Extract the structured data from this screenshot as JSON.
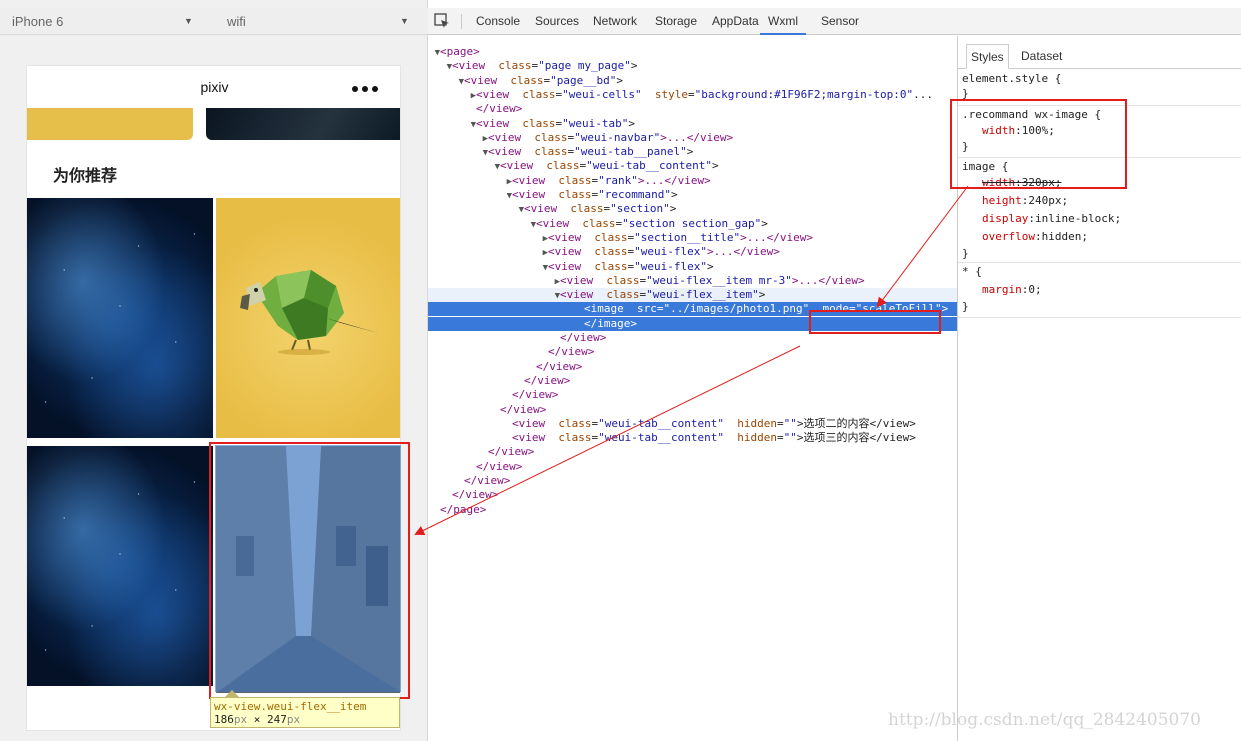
{
  "simulator": {
    "device": "iPhone 6",
    "network": "wifi",
    "nav_title": "pixiv",
    "section_title": "为你推荐",
    "tooltip_tag": "wx-view.weui-flex__item",
    "tooltip_width": "186",
    "tooltip_height": "247",
    "tooltip_unit": "px",
    "tooltip_times": "×"
  },
  "devtools": {
    "tabs": [
      "Console",
      "Sources",
      "Network",
      "Storage",
      "AppData",
      "Wxml",
      "Sensor"
    ],
    "active_tab": "Wxml",
    "wxml": [
      {
        "tri": "▼",
        "tag": "<page>",
        "a1": "",
        "v1": "",
        "a2": "",
        "v2": "",
        "rest": ""
      },
      {
        "tri": "▼",
        "tag": "<view",
        "a1": "class",
        "v1": "\"page my_page\"",
        "a2": "",
        "v2": "",
        "rest": ">"
      },
      {
        "tri": "▼",
        "tag": "<view",
        "a1": "class",
        "v1": "\"page__bd\"",
        "a2": "",
        "v2": "",
        "rest": ">"
      },
      {
        "tri": "▶",
        "tag": "<view",
        "a1": "class",
        "v1": "\"weui-cells\"",
        "a2": "style",
        "v2": "\"background:#1F96F2;margin-top:0\"",
        "rest": "..."
      },
      {
        "tri": "",
        "tag": "</view>",
        "a1": "",
        "v1": "",
        "a2": "",
        "v2": "",
        "rest": ""
      },
      {
        "tri": "▼",
        "tag": "<view",
        "a1": "class",
        "v1": "\"weui-tab\"",
        "a2": "",
        "v2": "",
        "rest": ">"
      },
      {
        "tri": "▶",
        "tag": "<view",
        "a1": "class",
        "v1": "\"weui-navbar\"",
        "a2": "",
        "v2": "",
        "rest": ">...</view>"
      },
      {
        "tri": "▼",
        "tag": "<view",
        "a1": "class",
        "v1": "\"weui-tab__panel\"",
        "a2": "",
        "v2": "",
        "rest": ">"
      },
      {
        "tri": "▼",
        "tag": "<view",
        "a1": "class",
        "v1": "\"weui-tab__content\"",
        "a2": "",
        "v2": "",
        "rest": ">"
      },
      {
        "tri": "▶",
        "tag": "<view",
        "a1": "class",
        "v1": "\"rank\"",
        "a2": "",
        "v2": "",
        "rest": ">...</view>"
      },
      {
        "tri": "▼",
        "tag": "<view",
        "a1": "class",
        "v1": "\"recommand\"",
        "a2": "",
        "v2": "",
        "rest": ">"
      },
      {
        "tri": "▼",
        "tag": "<view",
        "a1": "class",
        "v1": "\"section\"",
        "a2": "",
        "v2": "",
        "rest": ">"
      },
      {
        "tri": "▼",
        "tag": "<view",
        "a1": "class",
        "v1": "\"section section_gap\"",
        "a2": "",
        "v2": "",
        "rest": ">"
      },
      {
        "tri": "▶",
        "tag": "<view",
        "a1": "class",
        "v1": "\"section__title\"",
        "a2": "",
        "v2": "",
        "rest": ">...</view>"
      },
      {
        "tri": "▶",
        "tag": "<view",
        "a1": "class",
        "v1": "\"weui-flex\"",
        "a2": "",
        "v2": "",
        "rest": ">...</view>"
      },
      {
        "tri": "▼",
        "tag": "<view",
        "a1": "class",
        "v1": "\"weui-flex\"",
        "a2": "",
        "v2": "",
        "rest": ">"
      },
      {
        "tri": "▶",
        "tag": "<view",
        "a1": "class",
        "v1": "\"weui-flex__item mr-3\"",
        "a2": "",
        "v2": "",
        "rest": ">...</view>"
      },
      {
        "tri": "▼",
        "tag": "<view",
        "a1": "class",
        "v1": "\"weui-flex__item\"",
        "a2": "",
        "v2": "",
        "rest": ">"
      },
      {
        "tri": "",
        "tag": "<image",
        "a1": "src",
        "v1": "\"../images/photo1.png\"",
        "a2": "mode",
        "v2": "\"scaleToFill\"",
        "rest": ">"
      },
      {
        "tri": "",
        "tag": "</image>",
        "a1": "",
        "v1": "",
        "a2": "",
        "v2": "",
        "rest": ""
      },
      {
        "tri": "",
        "tag": "</view>",
        "a1": "",
        "v1": "",
        "a2": "",
        "v2": "",
        "rest": ""
      },
      {
        "tri": "",
        "tag": "</view>",
        "a1": "",
        "v1": "",
        "a2": "",
        "v2": "",
        "rest": ""
      },
      {
        "tri": "",
        "tag": "</view>",
        "a1": "",
        "v1": "",
        "a2": "",
        "v2": "",
        "rest": ""
      },
      {
        "tri": "",
        "tag": "</view>",
        "a1": "",
        "v1": "",
        "a2": "",
        "v2": "",
        "rest": ""
      },
      {
        "tri": "",
        "tag": "</view>",
        "a1": "",
        "v1": "",
        "a2": "",
        "v2": "",
        "rest": ""
      },
      {
        "tri": "",
        "tag": "</view>",
        "a1": "",
        "v1": "",
        "a2": "",
        "v2": "",
        "rest": ""
      },
      {
        "tri": "",
        "tag": "<view",
        "a1": "class",
        "v1": "\"weui-tab__content\"",
        "a2": "hidden",
        "v2": "\"\"",
        "rest": ">选项二的内容</view>"
      },
      {
        "tri": "",
        "tag": "<view",
        "a1": "class",
        "v1": "\"weui-tab__content\"",
        "a2": "hidden",
        "v2": "\"\"",
        "rest": ">选项三的内容</view>"
      },
      {
        "tri": "",
        "tag": "</view>",
        "a1": "",
        "v1": "",
        "a2": "",
        "v2": "",
        "rest": ""
      },
      {
        "tri": "",
        "tag": "</view>",
        "a1": "",
        "v1": "",
        "a2": "",
        "v2": "",
        "rest": ""
      },
      {
        "tri": "",
        "tag": "</view>",
        "a1": "",
        "v1": "",
        "a2": "",
        "v2": "",
        "rest": ""
      },
      {
        "tri": "",
        "tag": "</view>",
        "a1": "",
        "v1": "",
        "a2": "",
        "v2": "",
        "rest": ""
      },
      {
        "tri": "",
        "tag": "</page>",
        "a1": "",
        "v1": "",
        "a2": "",
        "v2": "",
        "rest": ""
      }
    ]
  },
  "styles": {
    "tabs": [
      "Styles",
      "Dataset"
    ],
    "active_tab": "Styles",
    "element_style": "element.style {",
    "r1_selector": ".recommand wx-image {",
    "r1_prop": "width",
    "r1_val": "100%;",
    "r2_selector": "image {",
    "r2_p1": "width",
    "r2_v1": "320px;",
    "r2_p2": "height",
    "r2_v2": "240px;",
    "r2_p3": "display",
    "r2_v3": "inline-block;",
    "r2_p4": "overflow",
    "r2_v4": "hidden;",
    "r3_selector": "* {",
    "r3_prop": "margin",
    "r3_val": "0;",
    "close": "}"
  },
  "watermark": "http://blog.csdn.net/qq_2842405070",
  "colors": {
    "selection": "#3879d9",
    "annotation": "#e21d1d",
    "highlight": "#3d78c4"
  }
}
